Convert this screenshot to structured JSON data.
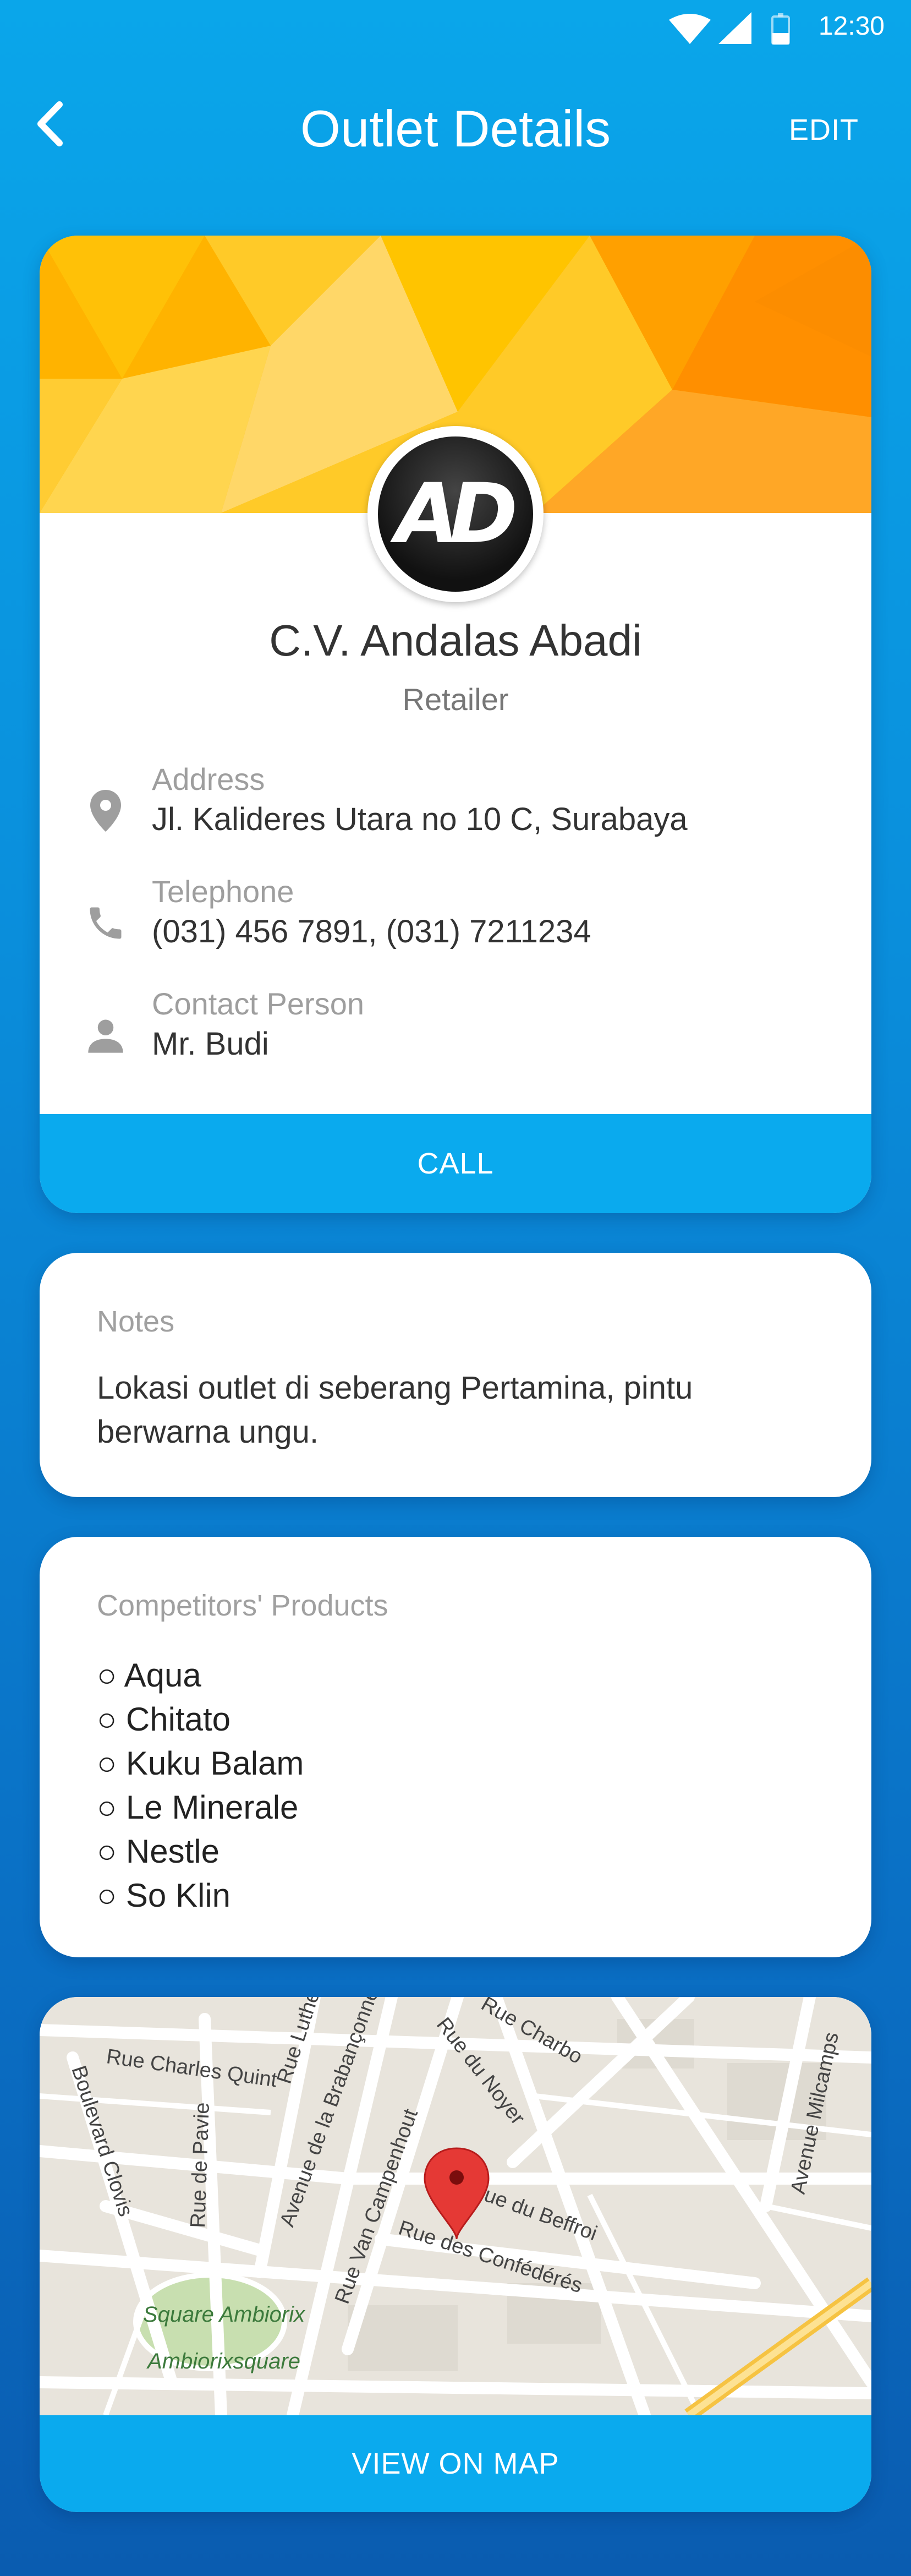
{
  "status_bar": {
    "time": "12:30",
    "icons": [
      "wifi-icon",
      "signal-icon",
      "battery-icon"
    ]
  },
  "header": {
    "title": "Outlet Details",
    "edit_label": "EDIT",
    "back_icon": "back-arrow-icon"
  },
  "outlet": {
    "initials": "AD",
    "name": "C.V. Andalas Abadi",
    "type": "Retailer",
    "address_label": "Address",
    "address": "Jl. Kalideres Utara no 10 C, Surabaya",
    "telephone_label": "Telephone",
    "telephone": "(031) 456 7891, (031) 7211234",
    "contact_label": "Contact Person",
    "contact": "Mr. Budi",
    "call_label": "CALL"
  },
  "notes": {
    "label": "Notes",
    "text": "Lokasi outlet di seberang Pertamina, pintu berwarna ungu."
  },
  "competitors": {
    "label": "Competitors' Products",
    "items": [
      "○ Aqua",
      "○ Chitato",
      "○ Kuku Balam",
      "○ Le Minerale",
      "○ Nestle",
      "○ So Klin"
    ]
  },
  "map": {
    "streets": [
      "Rue Charles Quint",
      "Boulevard Clovis",
      "Rue de Pavie",
      "Avenue de la Brabançonne",
      "Rue Van Campenhout",
      "Rue du Noyer",
      "Rue du Beffroi",
      "Rue des Confédérés",
      "Avenue Milcamps",
      "Rue Luther",
      "Rue Charbo",
      "Square Ambiorix",
      "Ambiorixsquare"
    ],
    "button_label": "VIEW ON MAP"
  },
  "colors": {
    "accent": "#0aaaee",
    "background_top": "#0aa6ea",
    "background_bottom": "#0a5cb0",
    "banner": "#ffb300",
    "pin": "#e53935"
  }
}
